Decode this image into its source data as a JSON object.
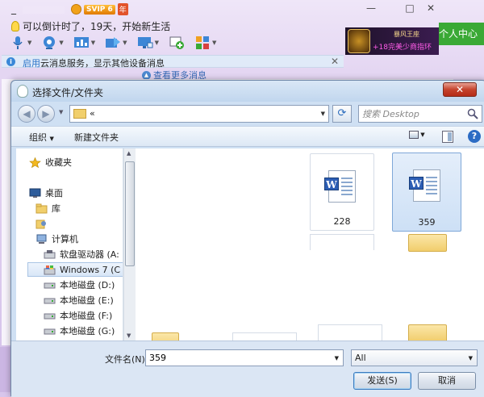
{
  "qq": {
    "name_prefix": "_",
    "svip_label": "SVIP 6",
    "year_label": "年",
    "minimize": "—",
    "maximize": "□",
    "close": "✕",
    "status_message": "可以倒计时了，19天，开始新生活",
    "ad_line1": "暴风王座",
    "ad_line2": "+18完美少商指环",
    "personal_center": "个人中心",
    "info_highlight": "启用",
    "info_rest": "云消息服务，显示其他设备消息",
    "info_close": "✕",
    "view_more": "查看更多消息"
  },
  "dialog": {
    "title": "选择文件/文件夹",
    "close": "✕",
    "address_text": "«",
    "search_placeholder": "搜索 Desktop",
    "organize": "组织",
    "new_folder": "新建文件夹",
    "help": "?",
    "nav": [
      {
        "label": "收藏夹",
        "icon": "star-icon"
      },
      {
        "label": "桌面",
        "icon": "desktop-icon"
      },
      {
        "label": "库",
        "icon": "library-icon"
      },
      {
        "label": "",
        "icon": "user-folder-icon"
      },
      {
        "label": "计算机",
        "icon": "computer-icon"
      },
      {
        "label": "软盘驱动器 (A:",
        "icon": "floppy-drive-icon"
      },
      {
        "label": "Windows 7 (C",
        "icon": "windows-drive-icon"
      },
      {
        "label": "本地磁盘 (D:)",
        "icon": "hard-disk-icon"
      },
      {
        "label": "本地磁盘 (E:)",
        "icon": "hard-disk-icon"
      },
      {
        "label": "本地磁盘 (F:)",
        "icon": "hard-disk-icon"
      },
      {
        "label": "本地磁盘 (G:)",
        "icon": "hard-disk-icon"
      }
    ],
    "files": [
      {
        "name": "228",
        "type": "word-doc"
      },
      {
        "name": "359",
        "type": "word-doc",
        "selected": true
      }
    ],
    "filename_label": "文件名(N):",
    "filename_value": "359",
    "filetype_value": "All",
    "send_button": "发送(S)",
    "cancel_button": "取消"
  }
}
